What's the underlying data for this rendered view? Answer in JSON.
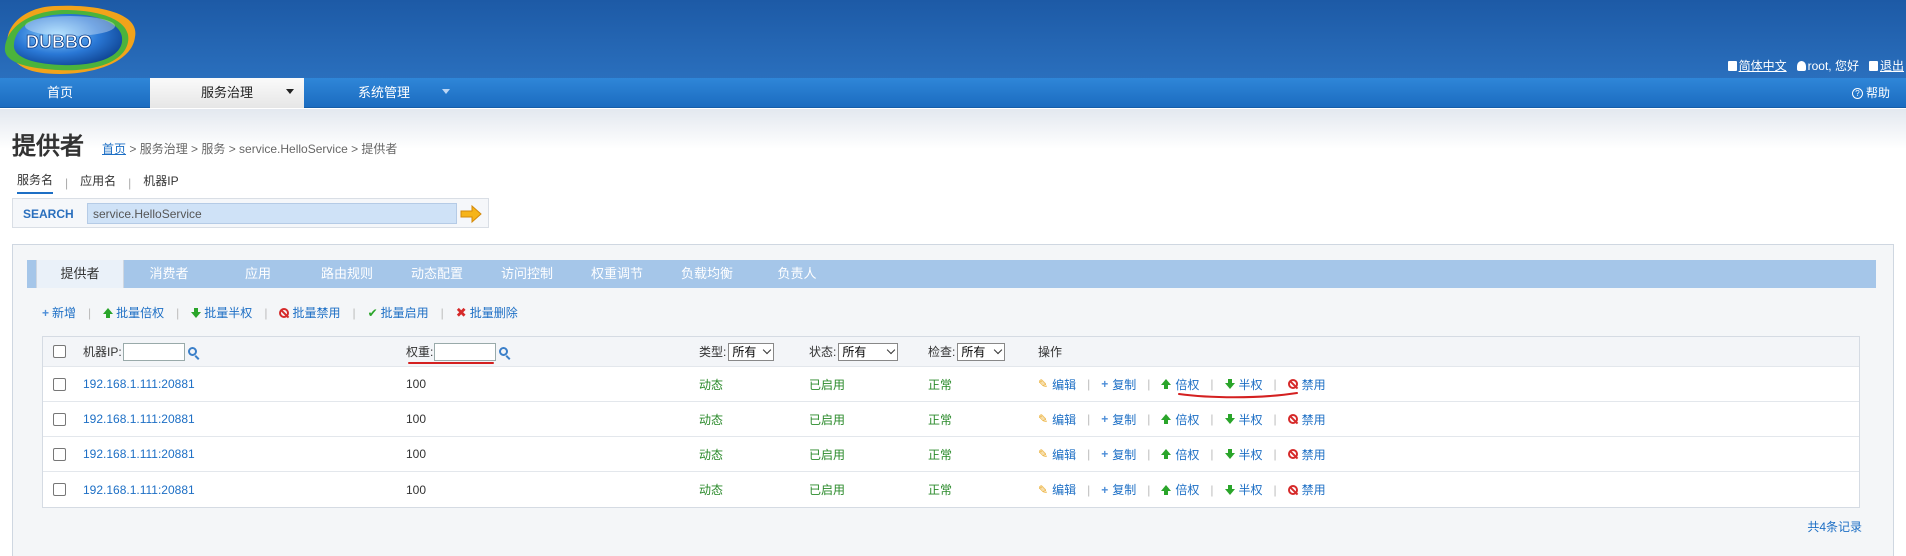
{
  "header": {
    "logo_text": "DUBBO",
    "lang_label": "简体中文",
    "user_label": "root, 您好",
    "logout_label": "退出"
  },
  "nav": {
    "items": [
      {
        "label": "首页"
      },
      {
        "label": "服务治理"
      },
      {
        "label": "系统管理"
      }
    ],
    "help_label": "帮助"
  },
  "page": {
    "title": "提供者",
    "breadcrumb": {
      "home": "首页",
      "rest": " > 服务治理 > 服务 > service.HelloService > 提供者"
    }
  },
  "search": {
    "tabs": [
      "服务名",
      "应用名",
      "机器IP"
    ],
    "label": "SEARCH",
    "value": "service.HelloService"
  },
  "tabs": [
    "提供者",
    "消费者",
    "应用",
    "路由规则",
    "动态配置",
    "访问控制",
    "权重调节",
    "负载均衡",
    "负责人"
  ],
  "toolbar": {
    "add": "新增",
    "batch_double": "批量倍权",
    "batch_half": "批量半权",
    "batch_disable": "批量禁用",
    "batch_enable": "批量启用",
    "batch_delete": "批量删除"
  },
  "table": {
    "headers": {
      "ip": "机器IP:",
      "weight": "权重:",
      "type": "类型:",
      "type_value": "所有",
      "status": "状态:",
      "status_value": "所有",
      "check": "检查:",
      "check_value": "所有",
      "ops": "操作"
    },
    "rows": [
      {
        "ip": "192.168.1.111:20881",
        "weight": "100",
        "type": "动态",
        "status": "已启用",
        "check": "正常"
      },
      {
        "ip": "192.168.1.111:20881",
        "weight": "100",
        "type": "动态",
        "status": "已启用",
        "check": "正常"
      },
      {
        "ip": "192.168.1.111:20881",
        "weight": "100",
        "type": "动态",
        "status": "已启用",
        "check": "正常"
      },
      {
        "ip": "192.168.1.111:20881",
        "weight": "100",
        "type": "动态",
        "status": "已启用",
        "check": "正常"
      }
    ],
    "ops": {
      "edit": "编辑",
      "copy": "复制",
      "double": "倍权",
      "half": "半权",
      "disable": "禁用"
    },
    "total": "共4条记录"
  },
  "colors": {
    "header_blue": "#1d5aa6",
    "nav_blue": "#2f86d8",
    "link_blue": "#1d6fc5",
    "status_green": "#2a8a2a",
    "annotation_red": "#d42020"
  }
}
